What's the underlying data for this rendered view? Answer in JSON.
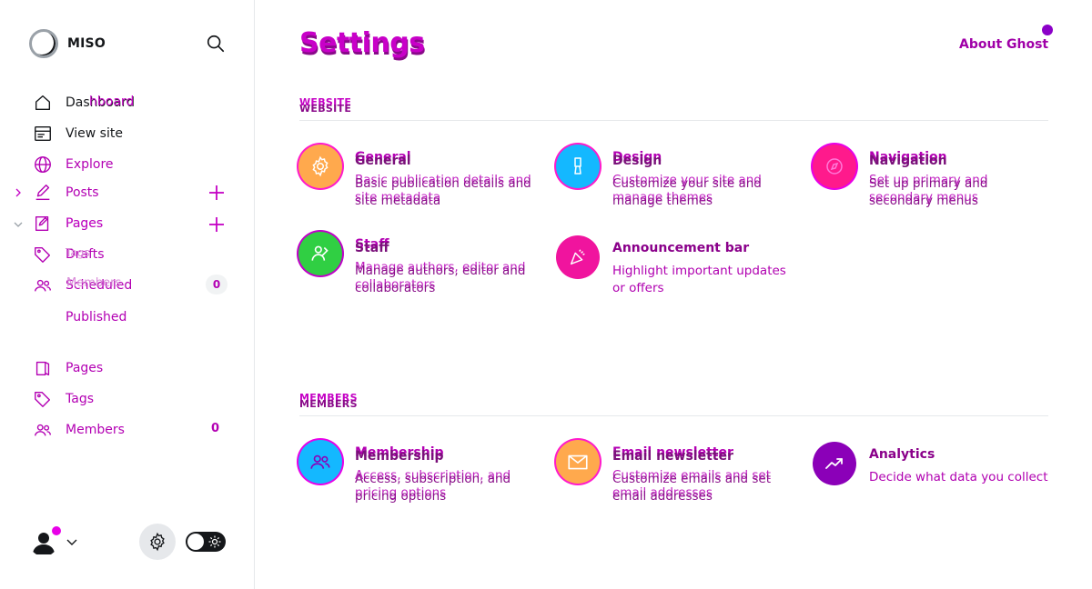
{
  "brand": {
    "name": "MISO"
  },
  "sidebar": {
    "nav": {
      "dashboard": "Dashboard",
      "dashboard_overlay": "hboard",
      "view_site": "View site",
      "explore": "Explore",
      "posts": "Posts",
      "pages_faded": "Pages",
      "pages_overlay": "Pages",
      "drafts": "Drafts",
      "tags_faded": "Tags",
      "members_faded": "Members",
      "scheduled": "Scheduled",
      "scheduled_count": "0",
      "published": "Published",
      "pages": "Pages",
      "tags": "Tags",
      "members": "Members",
      "members_count": "0"
    }
  },
  "header": {
    "title": "Settings",
    "about_link": "About Ghost"
  },
  "sections": {
    "website": {
      "label": "WEBSITE"
    },
    "members": {
      "label": "MEMBERS"
    }
  },
  "cards": {
    "general": {
      "title": "General",
      "desc": "Basic publication details and site metadata"
    },
    "design": {
      "title": "Design",
      "desc": "Customize your site and manage themes"
    },
    "navigation": {
      "title": "Navigation",
      "desc": "Set up primary and secondary menus"
    },
    "staff": {
      "title": "Staff",
      "desc": "Manage authors, editor and collaborators"
    },
    "announcement": {
      "title": "Announcement bar",
      "desc": "Highlight important updates or offers"
    },
    "membership": {
      "title": "Membership",
      "desc": "Access, subscription, and pricing options"
    },
    "email": {
      "title": "Email newsletter",
      "desc": "Customize emails and set email addresses"
    },
    "analytics": {
      "title": "Analytics",
      "desc": "Decide what data you collect"
    }
  },
  "colors": {
    "accent": "#c400c4",
    "accent_dark": "#8a008a",
    "general_icon": "#ffa94d",
    "design_icon": "#14b8ff",
    "navigation_icon": "#ff1a8c",
    "staff_icon": "#30cf43",
    "announcement_icon": "#f0149e",
    "membership_icon": "#14b8ff",
    "email_icon": "#ffa94d",
    "analytics_icon": "#8b00b8"
  },
  "icons": {
    "brand": "circle-logo-icon",
    "search": "search-icon",
    "settings": "gear-icon",
    "theme": "sun-icon"
  }
}
